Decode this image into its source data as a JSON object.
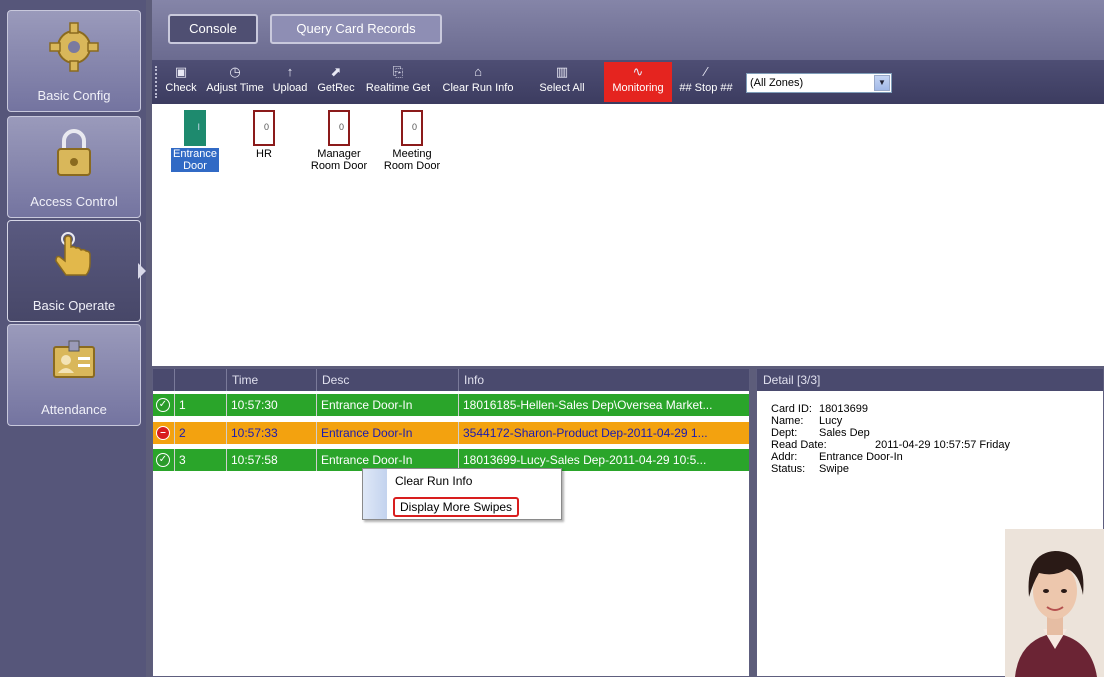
{
  "sidebar": {
    "items": [
      {
        "label": "Basic Config",
        "icon": "gear-icon"
      },
      {
        "label": "Access Control",
        "icon": "padlock-icon"
      },
      {
        "label": "Basic Operate",
        "icon": "hand-pointer-icon"
      },
      {
        "label": "Attendance",
        "icon": "id-card-icon"
      }
    ]
  },
  "tabs": {
    "console": "Console",
    "query": "Query Card Records"
  },
  "toolbar": {
    "buttons": [
      {
        "label": "Check",
        "icon": "doc-icon"
      },
      {
        "label": "Adjust Time",
        "icon": "clock-icon"
      },
      {
        "label": "Upload",
        "icon": "upload-arrow-icon"
      },
      {
        "label": "GetRec",
        "icon": "get-records-icon"
      },
      {
        "label": "Realtime Get",
        "icon": "realtime-icon"
      },
      {
        "label": "Clear Run Info",
        "icon": "trash-icon"
      },
      {
        "label": "Select All",
        "icon": "select-all-icon"
      },
      {
        "label": "Monitoring",
        "icon": "monitor-wave-icon"
      },
      {
        "label": "## Stop ##",
        "icon": "stop-icon"
      }
    ],
    "zone": "(All Zones)"
  },
  "doors": [
    {
      "label": "Entrance\nDoor",
      "line1": "Entrance",
      "line2": "Door",
      "knob": "I"
    },
    {
      "label": "HR",
      "line1": "HR",
      "line2": "",
      "knob": "0"
    },
    {
      "label": "Manager Room Door",
      "line1": "Manager",
      "line2": "Room Door",
      "knob": "0"
    },
    {
      "label": "Meeting Room Door",
      "line1": "Meeting",
      "line2": "Room Door",
      "knob": "0"
    }
  ],
  "grid": {
    "headers": [
      "Time",
      "Desc",
      "Info"
    ],
    "rows": [
      {
        "num": "1",
        "time": "10:57:30",
        "desc": "Entrance Door-In",
        "info": "18016185-Hellen-Sales Dep\\Oversea Market...",
        "status_mark": "✓"
      },
      {
        "num": "2",
        "time": "10:57:33",
        "desc": "Entrance Door-In",
        "info": "3544172-Sharon-Product Dep-2011-04-29 1...",
        "status_mark": "–"
      },
      {
        "num": "3",
        "time": "10:57:58",
        "desc": "Entrance Door-In",
        "info": "18013699-Lucy-Sales Dep-2011-04-29 10:5...",
        "status_mark": "✓"
      }
    ]
  },
  "context_menu": {
    "clear": "Clear Run Info",
    "more": "Display More Swipes"
  },
  "detail": {
    "title": "Detail  [3/3]",
    "card_id_k": "Card ID:",
    "card_id": "18013699",
    "name_k": "Name:",
    "name": "Lucy",
    "dept_k": "Dept:",
    "dept": "Sales Dep",
    "read_date_k": "Read Date:",
    "read_date": "2011-04-29 10:57:57 Friday",
    "addr_k": "Addr:",
    "addr": "Entrance Door-In",
    "status_k": "Status:",
    "status": "Swipe"
  }
}
